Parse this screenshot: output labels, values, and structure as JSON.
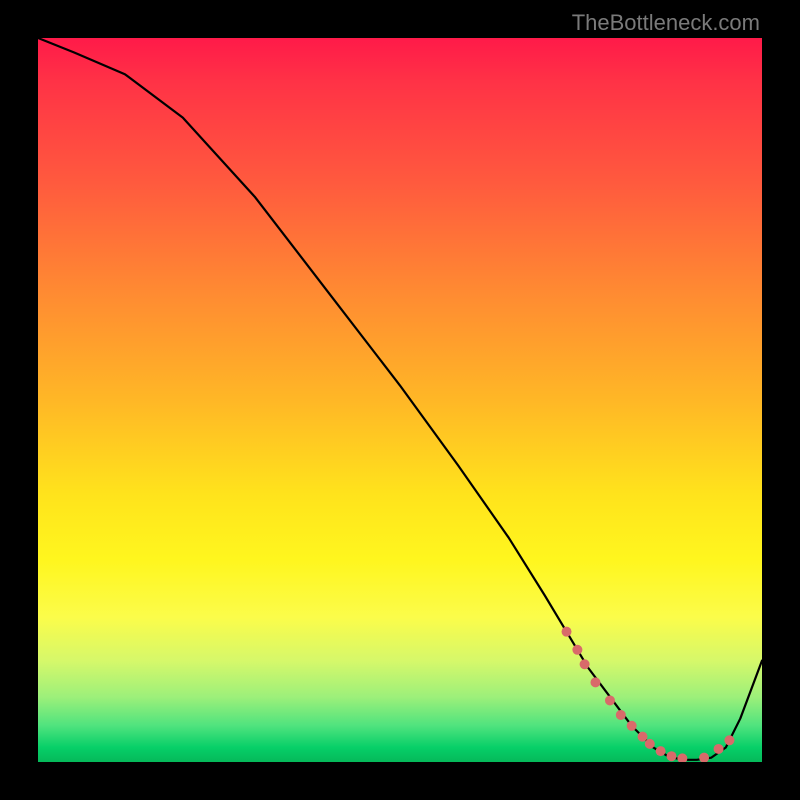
{
  "watermark": "TheBottleneck.com",
  "chart_data": {
    "type": "line",
    "title": "",
    "xlabel": "",
    "ylabel": "",
    "ylim": [
      0,
      100
    ],
    "xlim": [
      0,
      100
    ],
    "series": [
      {
        "name": "bottleneck-curve",
        "x": [
          0,
          5,
          12,
          20,
          30,
          40,
          50,
          58,
          65,
          70,
          73,
          76,
          79,
          82,
          85,
          87,
          89,
          91,
          93,
          95,
          97,
          100
        ],
        "y": [
          100,
          98,
          95,
          89,
          78,
          65,
          52,
          41,
          31,
          23,
          18,
          13,
          9,
          5,
          2,
          0.8,
          0.3,
          0.3,
          0.6,
          2,
          6,
          14
        ]
      }
    ],
    "markers": {
      "name": "highlight-dots",
      "color": "#d96a6a",
      "x": [
        73,
        74.5,
        75.5,
        77,
        79,
        80.5,
        82,
        83.5,
        84.5,
        86,
        87.5,
        89,
        92,
        94,
        95.5
      ],
      "y": [
        18,
        15.5,
        13.5,
        11,
        8.5,
        6.5,
        5,
        3.5,
        2.5,
        1.5,
        0.8,
        0.5,
        0.6,
        1.8,
        3
      ]
    },
    "background_gradient": {
      "top": "#ff1a49",
      "mid": "#ffe31c",
      "bottom": "#05b95a"
    }
  }
}
